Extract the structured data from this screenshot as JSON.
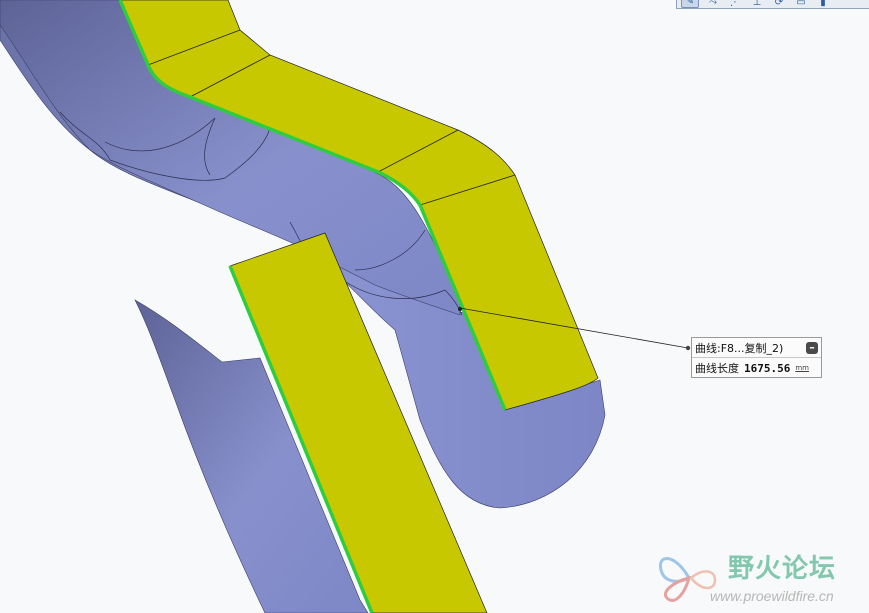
{
  "toolbar": {
    "icons": [
      "sketch-icon",
      "spline-icon",
      "points-icon",
      "axis-icon",
      "rotate-icon",
      "view-icon",
      "display-icon"
    ],
    "glyphs": [
      "✎",
      "⤳",
      "⋰",
      "⊥",
      "⟳",
      "▭",
      "▮"
    ]
  },
  "measure": {
    "curve_label": "曲线:F8...复制_2)",
    "length_label": "曲线长度",
    "length_value": "1675.56",
    "length_unit": "mm"
  },
  "watermark": {
    "title": "野火论坛",
    "url": "www.proewildfire.cn"
  },
  "colors": {
    "background": "#f8f9fa",
    "pipe_surface": "#8992cf",
    "flat_surface": "#c8c800",
    "selected_edge": "#2ecc40"
  }
}
